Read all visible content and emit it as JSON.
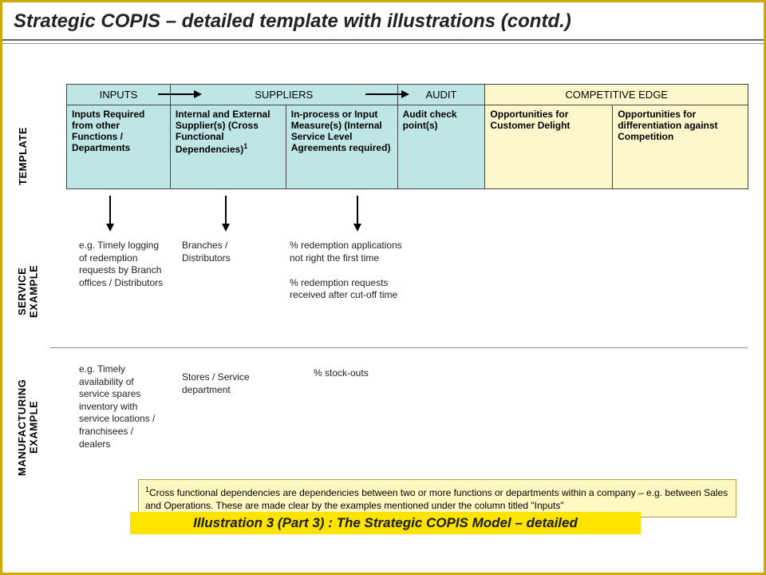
{
  "title": "Strategic COPIS – detailed template with illustrations (contd.)",
  "sections": {
    "template_label": "TEMPLATE",
    "service_label": "SERVICE\nEXAMPLE",
    "manufacturing_label": "MANUFACTURING\nEXAMPLE"
  },
  "headers": {
    "inputs": "INPUTS",
    "suppliers": "SUPPLIERS",
    "audit": "AUDIT",
    "comp_edge": "COMPETITIVE EDGE"
  },
  "cells": {
    "inputs": "Inputs Required from other Functions / Departments",
    "suppliers_a": "Internal and External Supplier(s) (Cross Functional Dependencies)",
    "suppliers_b": "In-process or Input Measure(s) (Internal Service Level Agreements required)",
    "audit": "Audit check point(s)",
    "edge_a": "Opportunities for Customer Delight",
    "edge_b": "Opportunities for differentiation against Competition"
  },
  "service_example": {
    "c1": "e.g. Timely logging of redemption requests by Branch offices / Distributors",
    "c2": "Branches / Distributors",
    "c3": "% redemption applications not right the first time\n\n% redemption requests received after cut-off time"
  },
  "mfg_example": {
    "c1": "e.g. Timely availability of service spares inventory with service locations / franchisees / dealers",
    "c2": "Stores / Service department",
    "c3": "% stock-outs"
  },
  "footnote": "Cross functional dependencies are dependencies between two or more functions or departments within a company – e.g. between Sales and Operations. These are made clear by the examples mentioned under the column titled \"Inputs\"",
  "caption": "Illustration 3 (Part 3) : The Strategic COPIS Model – detailed"
}
